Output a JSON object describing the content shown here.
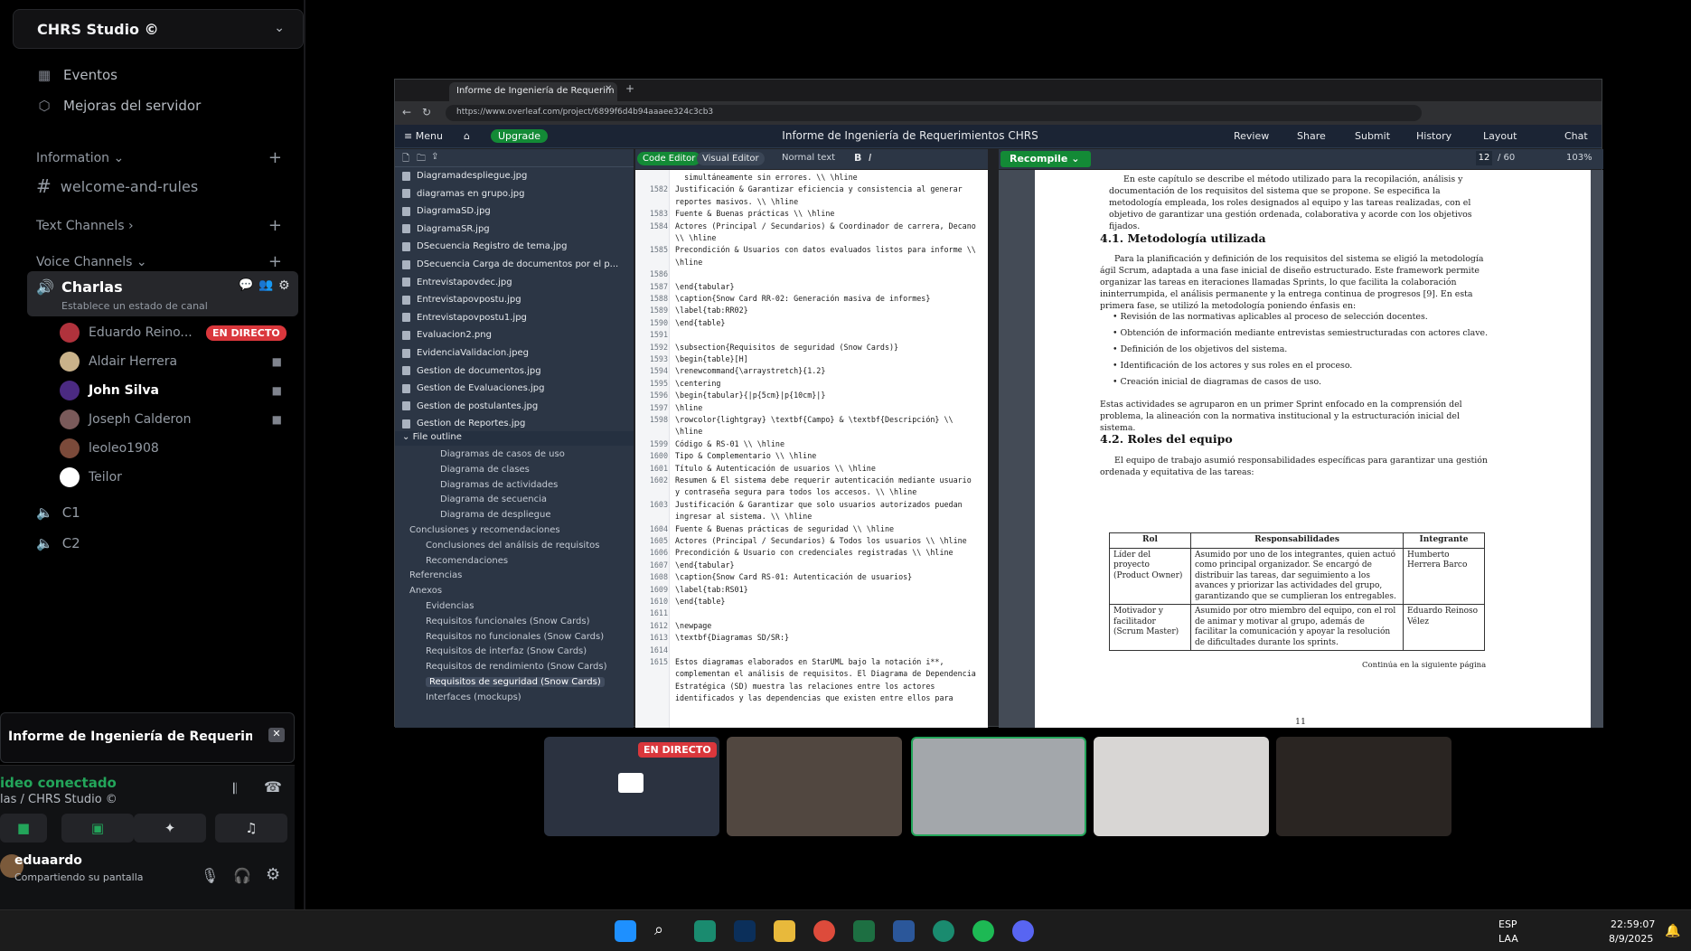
{
  "server": {
    "name": "CHRS Studio ©",
    "top_items": [
      {
        "label": "Eventos",
        "icon": "calendar-icon"
      },
      {
        "label": "Mejoras del servidor",
        "icon": "boost-icon"
      }
    ],
    "categories": {
      "information": "Information",
      "text_channels": "Text Channels",
      "voice_channels": "Voice Channels"
    },
    "welcome_channel": "welcome-and-rules",
    "voice_channel": {
      "name": "Charlas",
      "status_placeholder": "Establece un estado de canal"
    },
    "voice_users": [
      {
        "name": "Eduardo Reino...",
        "color": "#b0323c"
      },
      {
        "name": "Aldair Herrera",
        "color": "#c9b28a"
      },
      {
        "name": "John Silva",
        "color": "#4b2a82"
      },
      {
        "name": "Joseph Calderon",
        "color": "#7a5a5a"
      },
      {
        "name": "leoleo1908",
        "color": "#7b4a3a"
      },
      {
        "name": "Teilor",
        "color": "#ffffff"
      }
    ],
    "live_badge": "EN DIRECTO",
    "other_channels": [
      "C1",
      "C2"
    ]
  },
  "bottom_panel": {
    "stream_title": "Informe de Ingeniería de Requerimientos C...",
    "connection_status": "ideo conectado",
    "connection_location": "las / CHRS Studio ©",
    "user_name": "eduaardo",
    "user_status": "Compartiendo su pantalla"
  },
  "browser": {
    "tab_title": "Informe de Ingeniería de Requerim",
    "url": "https://www.overleaf.com/project/6899f6d4b94aaaee324c3cb3"
  },
  "overleaf": {
    "menu_label": "Menu",
    "upgrade_label": "Upgrade",
    "project_title": "Informe de Ingeniería de Requerimientos CHRS",
    "top_actions": [
      "Review",
      "Share",
      "Submit",
      "History",
      "Layout",
      "Chat"
    ],
    "code_editor_label": "Code Editor",
    "visual_editor_label": "Visual Editor",
    "text_style": "Normal text",
    "recompile_label": "Recompile",
    "page_current": "12",
    "page_total": "/ 60",
    "zoom": "103%",
    "files": [
      "Diagramadespliegue.jpg",
      "diagramas en grupo.jpg",
      "DiagramaSD.jpg",
      "DiagramaSR.jpg",
      "DSecuencia Registro de tema.jpg",
      "DSecuencia Carga de documentos por el p...",
      "Entrevistapovdec.jpg",
      "Entrevistapovpostu.jpg",
      "Entrevistapovpostu1.jpg",
      "Evaluacion2.png",
      "EvidenciaValidacion.jpeg",
      "Gestion de documentos.jpg",
      "Gestion de Evaluaciones.jpg",
      "Gestion de postulantes.jpg",
      "Gestion de Reportes.jpg"
    ],
    "outline_title": "File outline",
    "outline": [
      {
        "label": "Diagramas de casos de uso",
        "indent": 3
      },
      {
        "label": "Diagrama de clases",
        "indent": 3
      },
      {
        "label": "Diagramas de actividades",
        "indent": 3
      },
      {
        "label": "Diagrama de secuencia",
        "indent": 3
      },
      {
        "label": "Diagrama de despliegue",
        "indent": 3
      },
      {
        "label": "Conclusiones y recomendaciones",
        "indent": 1
      },
      {
        "label": "Conclusiones del análisis de requisitos",
        "indent": 2
      },
      {
        "label": "Recomendaciones",
        "indent": 2
      },
      {
        "label": "Referencias",
        "indent": 1
      },
      {
        "label": "Anexos",
        "indent": 1
      },
      {
        "label": "Evidencias",
        "indent": 2
      },
      {
        "label": "Requisitos funcionales (Snow Cards)",
        "indent": 2
      },
      {
        "label": "Requisitos no funcionales (Snow Cards)",
        "indent": 2
      },
      {
        "label": "Requisitos de interfaz (Snow Cards)",
        "indent": 2
      },
      {
        "label": "Requisitos de rendimiento (Snow Cards)",
        "indent": 2
      },
      {
        "label": "Requisitos de seguridad (Snow Cards)",
        "indent": 2,
        "selected": true
      },
      {
        "label": "Interfaces (mockups)",
        "indent": 2
      }
    ],
    "code_lines": [
      {
        "n": "",
        "t": "  simultáneamente sin errores. \\\\ \\hline"
      },
      {
        "n": "1582",
        "t": "Justificación & Garantizar eficiencia y consistencia al generar"
      },
      {
        "n": "",
        "t": "reportes masivos. \\\\ \\hline"
      },
      {
        "n": "1583",
        "t": "Fuente & Buenas prácticas \\\\ \\hline"
      },
      {
        "n": "1584",
        "t": "Actores (Principal / Secundarios) & Coordinador de carrera, Decano"
      },
      {
        "n": "",
        "t": "\\\\ \\hline"
      },
      {
        "n": "1585",
        "t": "Precondición & Usuarios con datos evaluados listos para informe \\\\"
      },
      {
        "n": "",
        "t": "\\hline"
      },
      {
        "n": "1586",
        "t": ""
      },
      {
        "n": "1587",
        "t": "\\end{tabular}"
      },
      {
        "n": "1588",
        "t": "\\caption{Snow Card RR-02: Generación masiva de informes}"
      },
      {
        "n": "1589",
        "t": "\\label{tab:RR02}"
      },
      {
        "n": "1590",
        "t": "\\end{table}"
      },
      {
        "n": "1591",
        "t": ""
      },
      {
        "n": "1592",
        "t": "\\subsection{Requisitos de seguridad (Snow Cards)}"
      },
      {
        "n": "1593",
        "t": "\\begin{table}[H]"
      },
      {
        "n": "1594",
        "t": "\\renewcommand{\\arraystretch}{1.2}"
      },
      {
        "n": "1595",
        "t": "\\centering"
      },
      {
        "n": "1596",
        "t": "\\begin{tabular}{|p{5cm}|p{10cm}|}"
      },
      {
        "n": "1597",
        "t": "\\hline"
      },
      {
        "n": "1598",
        "t": "\\rowcolor{lightgray} \\textbf{Campo} & \\textbf{Descripción} \\\\"
      },
      {
        "n": "",
        "t": "\\hline"
      },
      {
        "n": "1599",
        "t": "Código & RS-01 \\\\ \\hline"
      },
      {
        "n": "1600",
        "t": "Tipo & Complementario \\\\ \\hline"
      },
      {
        "n": "1601",
        "t": "Título & Autenticación de usuarios \\\\ \\hline"
      },
      {
        "n": "1602",
        "t": "Resumen & El sistema debe requerir autenticación mediante usuario"
      },
      {
        "n": "",
        "t": "y contraseña segura para todos los accesos. \\\\ \\hline"
      },
      {
        "n": "1603",
        "t": "Justificación & Garantizar que solo usuarios autorizados puedan"
      },
      {
        "n": "",
        "t": "ingresar al sistema. \\\\ \\hline"
      },
      {
        "n": "1604",
        "t": "Fuente & Buenas prácticas de seguridad \\\\ \\hline"
      },
      {
        "n": "1605",
        "t": "Actores (Principal / Secundarios) & Todos los usuarios \\\\ \\hline"
      },
      {
        "n": "1606",
        "t": "Precondición & Usuario con credenciales registradas \\\\ \\hline"
      },
      {
        "n": "1607",
        "t": "\\end{tabular}"
      },
      {
        "n": "1608",
        "t": "\\caption{Snow Card RS-01: Autenticación de usuarios}"
      },
      {
        "n": "1609",
        "t": "\\label{tab:RS01}"
      },
      {
        "n": "1610",
        "t": "\\end{table}"
      },
      {
        "n": "1611",
        "t": ""
      },
      {
        "n": "1612",
        "t": "\\newpage"
      },
      {
        "n": "1613",
        "t": "\\textbf{Diagramas SD/SR:}"
      },
      {
        "n": "1614",
        "t": ""
      },
      {
        "n": "1615",
        "t": "Estos diagramas elaborados en StarUML bajo la notación i**,"
      },
      {
        "n": "",
        "t": "complementan el análisis de requisitos. El Diagrama de Dependencia"
      },
      {
        "n": "",
        "t": "Estratégica (SD) muestra las relaciones entre los actores"
      },
      {
        "n": "",
        "t": "identificados y las dependencias que existen entre ellos para"
      }
    ],
    "pdf": {
      "intro": "En este capítulo se describe el método utilizado para la recopilación, análisis y documentación de los requisitos del sistema que se propone. Se especifica la metodología empleada, los roles designados al equipo y las tareas realizadas, con el objetivo de garantizar una gestión ordenada, colaborativa y acorde con los objetivos fijados.",
      "h1": "4.1.   Metodología utilizada",
      "p1": "Para la planificación y definición de los requisitos del sistema se eligió la metodología ágil Scrum, adaptada a una fase inicial de diseño estructurado. Este framework permite organizar las tareas en iteraciones llamadas Sprints, lo que facilita la colaboración ininterrumpida, el análisis permanente y la entrega continua de progresos [9]. En esta primera fase, se utilizó la metodología poniendo énfasis en:",
      "bullets": [
        "Revisión de las normativas aplicables al proceso de selección docentes.",
        "Obtención de información mediante entrevistas semiestructuradas con actores clave.",
        "Definición de los objetivos del sistema.",
        "Identificación de los actores y sus roles en el proceso.",
        "Creación inicial de diagramas de casos de uso."
      ],
      "p2": "Estas actividades se agruparon en un primer Sprint enfocado en la comprensión del problema, la alineación con la normativa institucional y la estructuración inicial del sistema.",
      "h2": "4.2.   Roles del equipo",
      "p3": "El equipo de trabajo asumió responsabilidades específicas para garantizar una gestión ordenada y equitativa de las tareas:",
      "table_headers": [
        "Rol",
        "Responsabilidades",
        "Integrante"
      ],
      "table_rows": [
        [
          "Líder del proyecto (Product Owner)",
          "Asumido por uno de los integrantes, quien actuó como principal organizador. Se encargó de distribuir las tareas, dar seguimiento a los avances y priorizar las actividades del grupo, garantizando que se cumplieran los entregables.",
          "Humberto Herrera Barco"
        ],
        [
          "Motivador y facilitador (Scrum Master)",
          "Asumido por otro miembro del equipo, con el rol de animar y motivar al grupo, además de facilitar la comunicación y apoyar la resolución de dificultades durante los sprints.",
          "Eduardo Reinoso Vélez"
        ]
      ],
      "continua": "Continúa en la siguiente página",
      "page_number": "11"
    }
  },
  "video_strip": {
    "live_badge": "EN DIRECTO"
  },
  "taskbar": {
    "lang": "ESP",
    "layout": "LAA",
    "time": "22:59:07",
    "date": "8/9/2025"
  }
}
